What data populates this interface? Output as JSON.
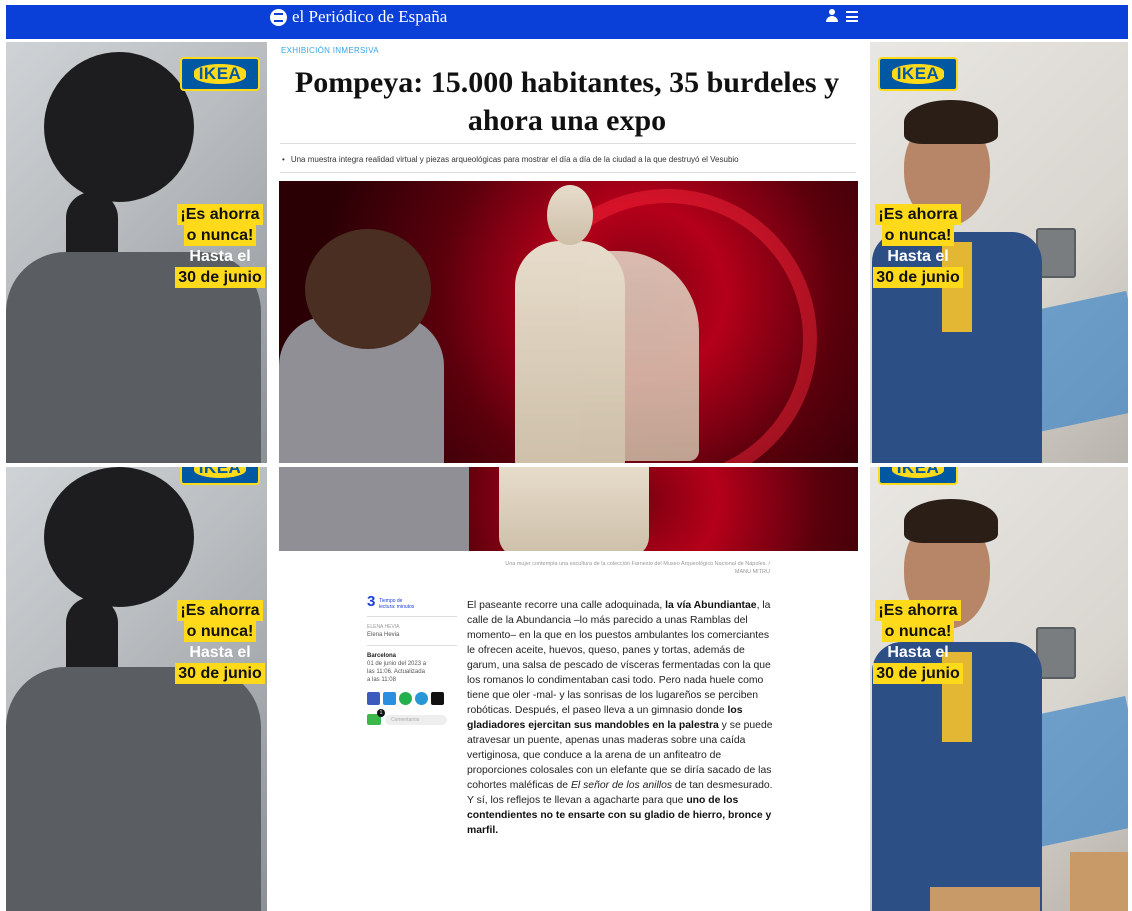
{
  "header": {
    "logo_text": "el Periódico de España",
    "brand_color": "#0a3fd8",
    "icons": [
      "user-icon",
      "menu-icon"
    ]
  },
  "ads": {
    "brand": "IKEA",
    "line1": "¡Es ahorra",
    "line2": "o nunca!",
    "line3": "Hasta el",
    "line4": "30 de junio",
    "accent": "#ffda1a",
    "ikea_blue": "#0058a3"
  },
  "article": {
    "kicker": "EXHIBICIÓN INMERSIVA",
    "headline": "Pompeya: 15.000 habitantes, 35 burdeles y ahora una expo",
    "subheadline": "Una muestra integra realidad virtual y piezas arqueológicas para mostrar el día a día de la ciudad a la que destruyó el Vesubio",
    "caption_line1": "Una mujer contempla una escultura de la colección Farnesio del Museo Arqueológico Nacional de Nápoles. /",
    "caption_line2": "MANU MITRU",
    "reading_time_number": "3",
    "reading_time_label1": "Tiempo de",
    "reading_time_label2": "lectura: minutos",
    "author_label": "ELENA HEVIA",
    "author": "Elena Hevia",
    "location": "Barcelona",
    "dateline": "01 de junio del 2023 a las 11:06. Actualizada a las 11:08",
    "comments_count": "1",
    "comments_label": "Comentarios",
    "body": [
      {
        "t": "El paseante recorre una calle adoquinada, ",
        "b": false
      },
      {
        "t": "la vía Abundiantae",
        "b": true
      },
      {
        "t": ", la calle de la Abundancia –lo más parecido a unas Ramblas del momento– en la que en los puestos ambulantes los comerciantes le ofrecen aceite, huevos, queso, panes y tortas, además de garum, una salsa de pescado de vísceras fermentadas con la que los romanos lo condimentaban casi todo. Pero nada huele como tiene que oler -mal- y las sonrisas de los lugareños se perciben robóticas. Después, el paseo lleva a un gimnasio donde ",
        "b": false
      },
      {
        "t": "los gladiadores ejercitan sus mandobles en la palestra",
        "b": true
      },
      {
        "t": " y se puede atravesar un puente, apenas unas maderas sobre una caída vertiginosa, que conduce a la arena de un anfiteatro de proporciones colosales con un elefante que se diría sacado de las cohortes maléficas de ",
        "b": false
      },
      {
        "t": "El señor de los anillos",
        "b": false,
        "i": true
      },
      {
        "t": " de tan desmesurado. Y sí, los reflejos te llevan a agacharte para que ",
        "b": false
      },
      {
        "t": "uno de los contendientes no te ensarte con su gladio de hierro, bronce y marfil.",
        "b": true
      }
    ]
  },
  "share_icons": [
    {
      "name": "facebook-icon",
      "color": "#3b5bbd"
    },
    {
      "name": "twitter-icon",
      "color": "#2a8fe0"
    },
    {
      "name": "whatsapp-icon",
      "color": "#25b04e"
    },
    {
      "name": "telegram-icon",
      "color": "#2797d6"
    },
    {
      "name": "email-icon",
      "color": "#111111"
    }
  ]
}
